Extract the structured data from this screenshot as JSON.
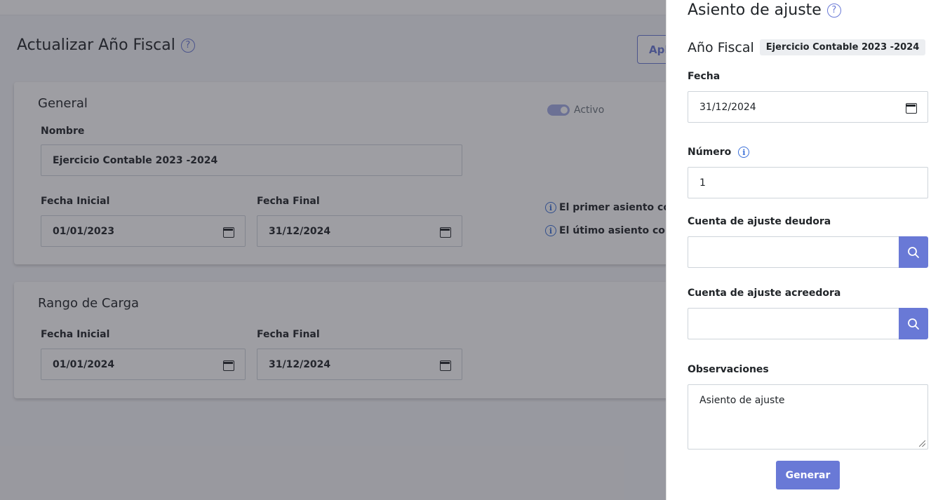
{
  "page": {
    "title": "Actualizar Año Fiscal",
    "top_action_label": "Aplicar",
    "general": {
      "title": "General",
      "nombre_label": "Nombre",
      "nombre_value": "Ejercicio Contable 2023 -2024",
      "activo_label": "Activo",
      "fecha_inicial_label": "Fecha Inicial",
      "fecha_inicial_value": "01/01/2023",
      "fecha_final_label": "Fecha Final",
      "fecha_final_value": "31/12/2024",
      "info_primer": "El primer asiento con",
      "info_ultimo": "El útimo asiento cont"
    },
    "rango": {
      "title": "Rango de Carga",
      "fecha_inicial_label": "Fecha Inicial",
      "fecha_inicial_value": "01/01/2024",
      "fecha_final_label": "Fecha Final",
      "fecha_final_value": "31/12/2024"
    }
  },
  "panel": {
    "title": "Asiento de ajuste",
    "year_label": "Año Fiscal",
    "year_badge": "Ejercicio Contable 2023 -2024",
    "fecha_label": "Fecha",
    "fecha_value": "31/12/2024",
    "numero_label": "Número",
    "numero_value": "1",
    "deudora_label": "Cuenta de ajuste deudora",
    "acreedora_label": "Cuenta de ajuste acreedora",
    "observaciones_label": "Observaciones",
    "observaciones_value": "Asiento de ajuste",
    "generar_label": "Generar"
  },
  "icons": {
    "help": "question-circle-icon",
    "info": "info-circle-icon",
    "calendar": "calendar-icon",
    "search": "search-icon"
  },
  "colors": {
    "primary": "#6979d6",
    "info": "#3a6fd8",
    "overlay": "rgba(40,40,50,0.45)"
  }
}
